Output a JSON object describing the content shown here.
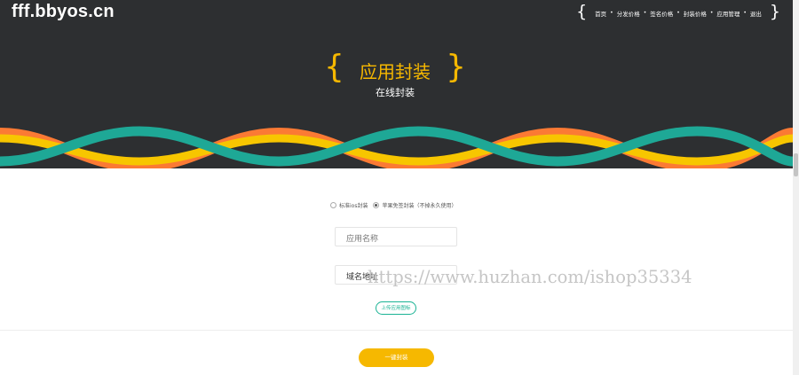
{
  "site": {
    "logo": "fff.bbyos.cn"
  },
  "nav": {
    "brace_open": "{",
    "brace_close": "}",
    "separator": "•",
    "items": [
      {
        "label": "首页"
      },
      {
        "label": "分发价格"
      },
      {
        "label": "签名价格"
      },
      {
        "label": "封装价格"
      },
      {
        "label": "应用管理"
      },
      {
        "label": "退出"
      }
    ]
  },
  "hero": {
    "brace_open": "{",
    "brace_close": "}",
    "title": "应用封装",
    "subtitle": "在线封装",
    "background_color": "#2d2f31",
    "accent_color": "#f6b800"
  },
  "wave_colors": {
    "teal": "#1ea896",
    "yellow": "#f7c600",
    "orange": "#fb7a34"
  },
  "form": {
    "radio_options": [
      {
        "label": "标准ios封装",
        "checked": false
      },
      {
        "label": "苹果免签封装（不掉永久使用）",
        "checked": true
      }
    ],
    "app_name": {
      "placeholder": "应用名称",
      "value": ""
    },
    "domain": {
      "placeholder": "",
      "value": "域名地址"
    },
    "upload_label": "上传应用图标",
    "submit_label": "一键封装"
  },
  "watermark": {
    "text": "https://www.huzhan.com/ishop35334"
  }
}
